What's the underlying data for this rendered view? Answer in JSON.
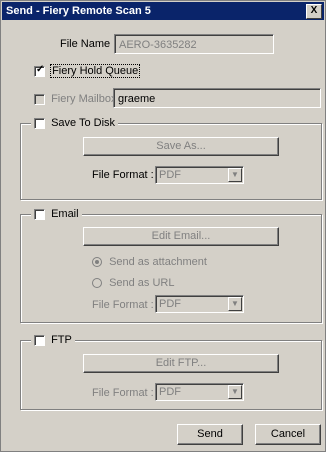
{
  "window": {
    "title": "Send - Fiery Remote Scan 5",
    "close_label": "X"
  },
  "file_name": {
    "label": "File Name :",
    "value": "AERO-3635282"
  },
  "hold_queue": {
    "label": "Fiery Hold Queue",
    "checked": true
  },
  "mailbox": {
    "label": "Fiery Mailbox",
    "value": "graeme"
  },
  "save_to_disk": {
    "label": "Save To Disk",
    "save_as": "Save As...",
    "format_label": "File Format :",
    "format_value": "PDF"
  },
  "email": {
    "label": "Email",
    "edit": "Edit Email...",
    "attach": "Send as attachment",
    "url": "Send as URL",
    "format_label": "File Format :",
    "format_value": "PDF"
  },
  "ftp": {
    "label": "FTP",
    "edit": "Edit FTP...",
    "format_label": "File Format :",
    "format_value": "PDF"
  },
  "buttons": {
    "send": "Send",
    "cancel": "Cancel"
  }
}
